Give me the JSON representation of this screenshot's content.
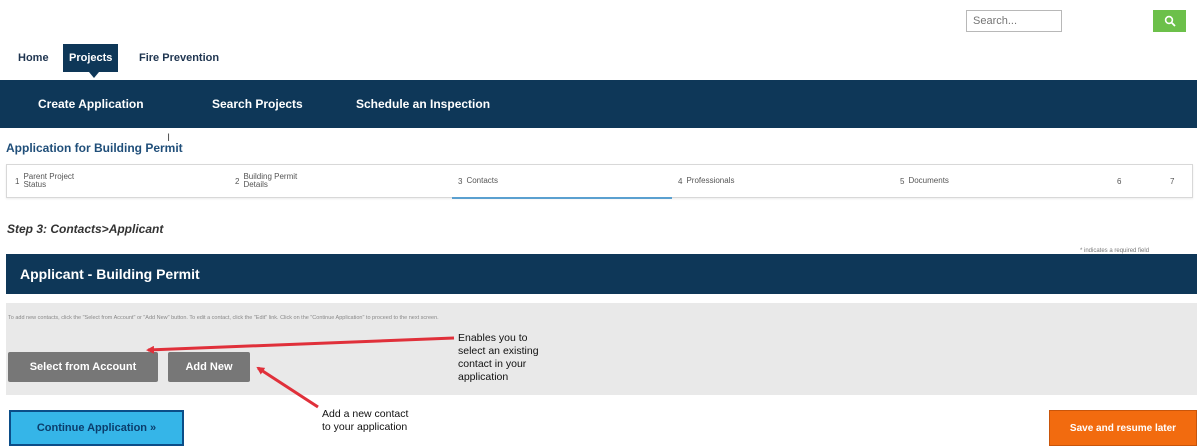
{
  "search": {
    "placeholder": "Search..."
  },
  "top_nav": {
    "home": "Home",
    "projects": "Projects",
    "fire": "Fire Prevention"
  },
  "sub_nav": {
    "create": "Create Application",
    "search": "Search Projects",
    "schedule": "Schedule an Inspection"
  },
  "page_title": "Application for Building Permit",
  "steps": [
    {
      "num": "1",
      "label": "Parent Project\nStatus"
    },
    {
      "num": "2",
      "label": "Building Permit\nDetails"
    },
    {
      "num": "3",
      "label": "Contacts"
    },
    {
      "num": "4",
      "label": "Professionals"
    },
    {
      "num": "5",
      "label": "Documents"
    },
    {
      "num": "6",
      "label": ""
    },
    {
      "num": "7",
      "label": ""
    }
  ],
  "step_heading": "Step 3: Contacts>Applicant",
  "required_note": "* indicates a required field",
  "panel": {
    "title": "Applicant - Building Permit",
    "instructions": "To add new contacts, click the \"Select from Account\" or \"Add New\" button. To edit a contact, click the \"Edit\" link. Click on the \"Continue Application\" to proceed to the next screen.",
    "select_label": "Select from Account",
    "add_label": "Add New"
  },
  "callouts": {
    "select": "Enables you to\nselect an existing\ncontact in your\napplication",
    "add": "Add a new contact\nto your application"
  },
  "footer": {
    "continue": "Continue Application »",
    "save": "Save and resume later"
  },
  "colors": {
    "navy": "#0e3758",
    "accent_blue": "#35b5e8",
    "orange": "#f26b0f",
    "green": "#6cc04a",
    "arrow_red": "#e0303a"
  }
}
